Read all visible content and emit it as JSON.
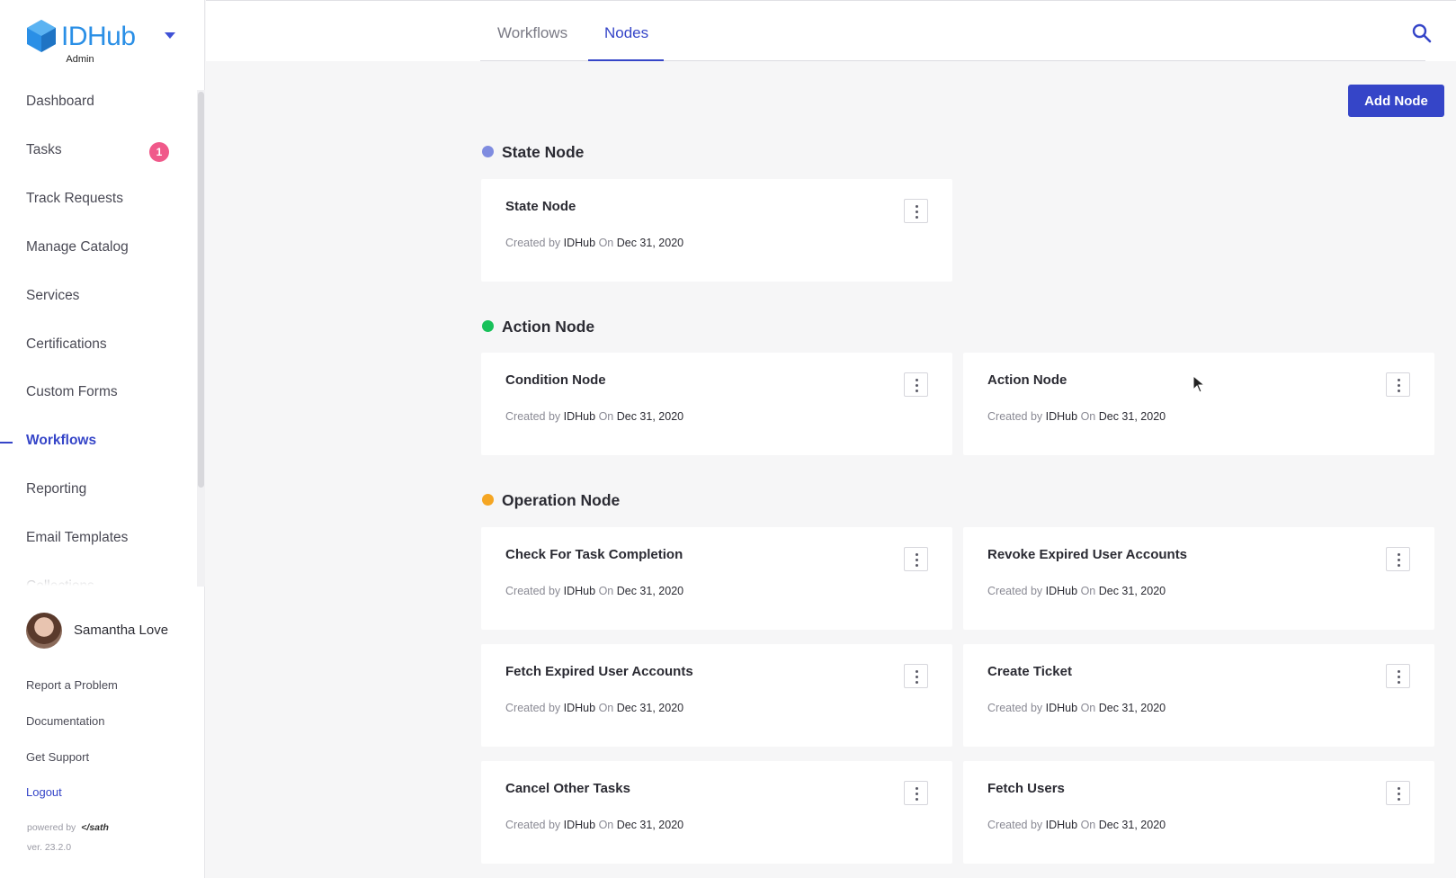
{
  "brand": {
    "name_id": "ID",
    "name_hub": "Hub",
    "subtitle": "Admin",
    "logo_icon": "hexagon-logo-icon"
  },
  "sidebar": {
    "items": [
      {
        "label": "Dashboard"
      },
      {
        "label": "Tasks",
        "badge": "1"
      },
      {
        "label": "Track Requests"
      },
      {
        "label": "Manage Catalog"
      },
      {
        "label": "Services"
      },
      {
        "label": "Certifications"
      },
      {
        "label": "Custom Forms"
      },
      {
        "label": "Workflows",
        "active": true
      },
      {
        "label": "Reporting"
      },
      {
        "label": "Email Templates"
      },
      {
        "label": "Collections"
      }
    ]
  },
  "user": {
    "name": "Samantha Love"
  },
  "footer": {
    "report": "Report a Problem",
    "docs": "Documentation",
    "support": "Get Support",
    "logout": "Logout",
    "powered_by": "powered by",
    "powered_brand": "</sath",
    "version": "ver. 23.2.0"
  },
  "tabs": [
    {
      "label": "Workflows",
      "active": false
    },
    {
      "label": "Nodes",
      "active": true
    }
  ],
  "actions": {
    "add_node": "Add Node"
  },
  "colors": {
    "accent": "#3545c8",
    "state": "#7f8ce0",
    "action": "#18c15a",
    "operation": "#f5a623",
    "badge": "#f0598a"
  },
  "sections": [
    {
      "title": "State Node",
      "cards": [
        {
          "title": "State Node",
          "created_by_label": "Created by",
          "author": "IDHub",
          "on_label": "On",
          "date": "Dec 31, 2020"
        }
      ]
    },
    {
      "title": "Action Node",
      "cards": [
        {
          "title": "Condition Node",
          "created_by_label": "Created by",
          "author": "IDHub",
          "on_label": "On",
          "date": "Dec 31, 2020"
        },
        {
          "title": "Action Node",
          "created_by_label": "Created by",
          "author": "IDHub",
          "on_label": "On",
          "date": "Dec 31, 2020"
        }
      ]
    },
    {
      "title": "Operation Node",
      "cards": [
        {
          "title": "Check For Task Completion",
          "created_by_label": "Created by",
          "author": "IDHub",
          "on_label": "On",
          "date": "Dec 31, 2020"
        },
        {
          "title": "Revoke Expired User Accounts",
          "created_by_label": "Created by",
          "author": "IDHub",
          "on_label": "On",
          "date": "Dec 31, 2020"
        },
        {
          "title": "Fetch Expired User Accounts",
          "created_by_label": "Created by",
          "author": "IDHub",
          "on_label": "On",
          "date": "Dec 31, 2020"
        },
        {
          "title": "Create Ticket",
          "created_by_label": "Created by",
          "author": "IDHub",
          "on_label": "On",
          "date": "Dec 31, 2020"
        },
        {
          "title": "Cancel Other Tasks",
          "created_by_label": "Created by",
          "author": "IDHub",
          "on_label": "On",
          "date": "Dec 31, 2020"
        },
        {
          "title": "Fetch Users",
          "created_by_label": "Created by",
          "author": "IDHub",
          "on_label": "On",
          "date": "Dec 31, 2020"
        }
      ]
    }
  ]
}
